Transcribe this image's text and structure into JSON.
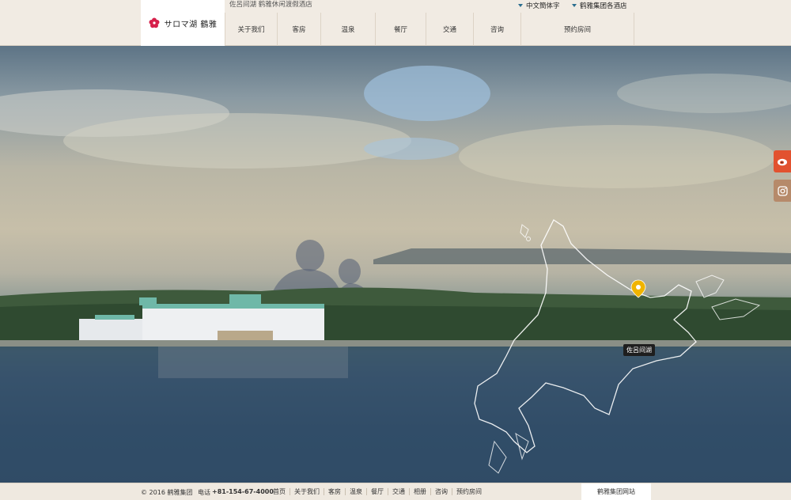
{
  "header": {
    "logo_text": "サロマ湖 鶴雅",
    "site_title": "佐呂间湖 鹤雅休闲渡假酒店",
    "language": "中文簡体字",
    "group_hotels": "鹤雅集团各酒店"
  },
  "nav": {
    "items": [
      "关于我们",
      "客房",
      "温泉",
      "餐厅",
      "交通",
      "咨询",
      "预约房间"
    ]
  },
  "hero": {
    "map_label": "佐呂间湖",
    "slides_count": 8,
    "active_slide": 1,
    "pin_color": "#f0b400"
  },
  "footer": {
    "copyright": "© 2016 鹤雅集团",
    "phone_label": "电话",
    "phone": "+81-154-67-4000",
    "links": [
      "首页",
      "关于我们",
      "客房",
      "温泉",
      "餐厅",
      "交通",
      "相册",
      "咨询",
      "预约房间"
    ],
    "group_site": "鹤雅集团网站"
  },
  "colors": {
    "accent": "#2b6e8f",
    "weibo": "#e2522f",
    "instagram": "#b68a6a"
  }
}
